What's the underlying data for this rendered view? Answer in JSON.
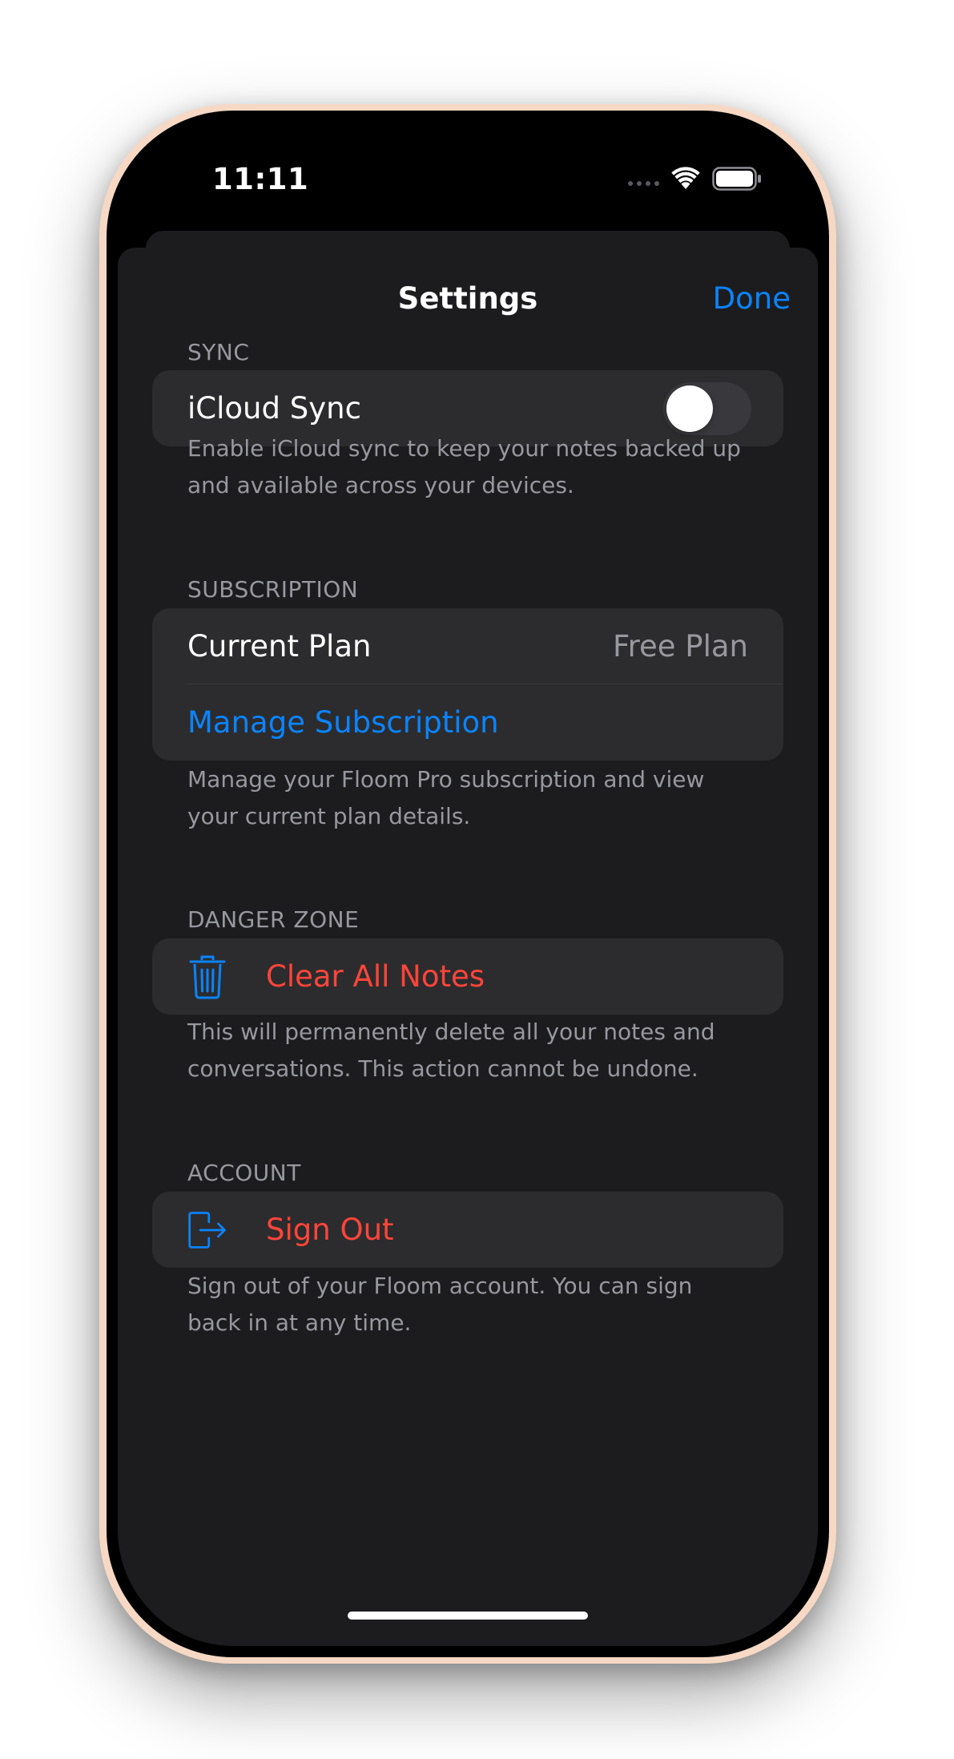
{
  "status_bar": {
    "time": "11:11"
  },
  "nav": {
    "title": "Settings",
    "done_label": "Done"
  },
  "sections": {
    "sync": {
      "header": "SYNC",
      "icloud_label": "iCloud Sync",
      "icloud_enabled": false,
      "footer": "Enable iCloud sync to keep your notes backed up and available across your devices."
    },
    "subscription": {
      "header": "SUBSCRIPTION",
      "current_plan_label": "Current Plan",
      "current_plan_value": "Free Plan",
      "manage_label": "Manage Subscription",
      "footer": "Manage your Floom Pro subscription and view your current plan details."
    },
    "danger": {
      "header": "DANGER ZONE",
      "clear_label": "Clear All Notes",
      "clear_icon": "trash-icon",
      "footer": "This will permanently delete all your notes and conversations. This action cannot be undone."
    },
    "account": {
      "header": "ACCOUNT",
      "signout_label": "Sign Out",
      "signout_icon": "sign-out-icon",
      "footer": "Sign out of your Floom account. You can sign back in at any time."
    }
  },
  "colors": {
    "accent": "#0a84ff",
    "destructive": "#ff453a",
    "background": "#1c1c1e",
    "cell": "#2c2c2e",
    "secondary_text": "#98989f",
    "frame": "#f6d8c4"
  }
}
